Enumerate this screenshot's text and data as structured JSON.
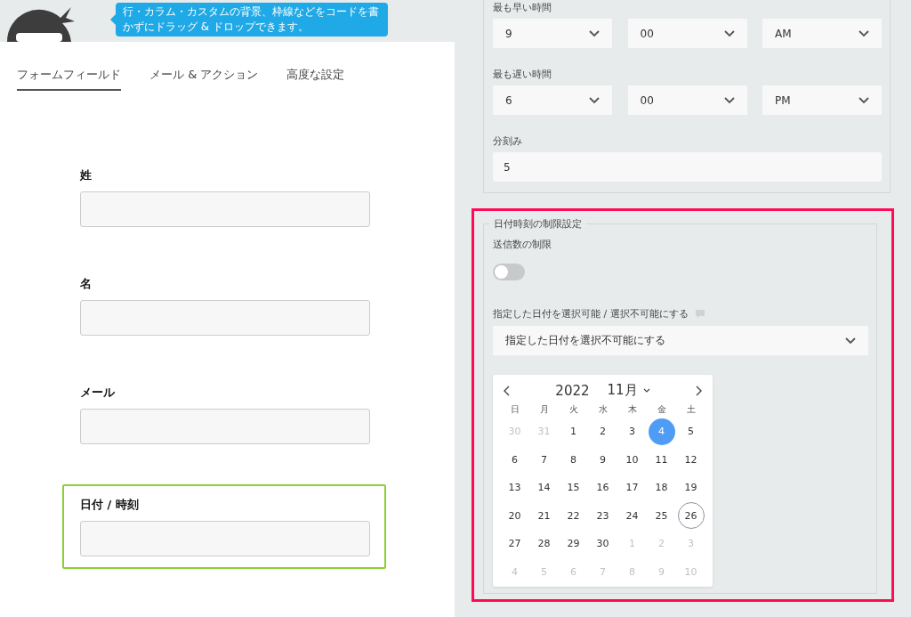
{
  "tooltip": "行・カラム・カスタムの背景、枠線などをコードを書かずにドラッグ & ドロップできます。",
  "tabs": [
    {
      "label": "フォームフィールド",
      "selected": true
    },
    {
      "label": "メール & アクション",
      "selected": false
    },
    {
      "label": "高度な設定",
      "selected": false
    }
  ],
  "fields": [
    {
      "label": "姓",
      "selected": false
    },
    {
      "label": "名",
      "selected": false
    },
    {
      "label": "メール",
      "selected": false
    },
    {
      "label": "日付 / 時刻",
      "selected": true
    }
  ],
  "time_settings": [
    {
      "label": "最も早い時間",
      "hour": "9",
      "minute": "00",
      "period": "AM"
    },
    {
      "label": "最も遅い時間",
      "hour": "6",
      "minute": "00",
      "period": "PM"
    }
  ],
  "interval": {
    "label": "分刻み",
    "value": "5"
  },
  "restrictions": {
    "legend": "日付時刻の制限設定",
    "limit_label": "送信数の制限",
    "limit_on": false,
    "dates_label": "指定した日付を選択可能 / 選択不可能にする",
    "dates_mode": "指定した日付を選択不可能にする"
  },
  "calendar": {
    "year": "2022",
    "month": "11月",
    "weekdays": [
      "日",
      "月",
      "火",
      "水",
      "木",
      "金",
      "土"
    ],
    "days": [
      {
        "text": "30",
        "outside": true,
        "selected": false,
        "today": false
      },
      {
        "text": "31",
        "outside": true,
        "selected": false,
        "today": false
      },
      {
        "text": "1",
        "outside": false,
        "selected": false,
        "today": false
      },
      {
        "text": "2",
        "outside": false,
        "selected": false,
        "today": false
      },
      {
        "text": "3",
        "outside": false,
        "selected": false,
        "today": false
      },
      {
        "text": "4",
        "outside": false,
        "selected": true,
        "today": false
      },
      {
        "text": "5",
        "outside": false,
        "selected": false,
        "today": false
      },
      {
        "text": "6",
        "outside": false,
        "selected": false,
        "today": false
      },
      {
        "text": "7",
        "outside": false,
        "selected": false,
        "today": false
      },
      {
        "text": "8",
        "outside": false,
        "selected": false,
        "today": false
      },
      {
        "text": "9",
        "outside": false,
        "selected": false,
        "today": false
      },
      {
        "text": "10",
        "outside": false,
        "selected": false,
        "today": false
      },
      {
        "text": "11",
        "outside": false,
        "selected": false,
        "today": false
      },
      {
        "text": "12",
        "outside": false,
        "selected": false,
        "today": false
      },
      {
        "text": "13",
        "outside": false,
        "selected": false,
        "today": false
      },
      {
        "text": "14",
        "outside": false,
        "selected": false,
        "today": false
      },
      {
        "text": "15",
        "outside": false,
        "selected": false,
        "today": false
      },
      {
        "text": "16",
        "outside": false,
        "selected": false,
        "today": false
      },
      {
        "text": "17",
        "outside": false,
        "selected": false,
        "today": false
      },
      {
        "text": "18",
        "outside": false,
        "selected": false,
        "today": false
      },
      {
        "text": "19",
        "outside": false,
        "selected": false,
        "today": false
      },
      {
        "text": "20",
        "outside": false,
        "selected": false,
        "today": false
      },
      {
        "text": "21",
        "outside": false,
        "selected": false,
        "today": false
      },
      {
        "text": "22",
        "outside": false,
        "selected": false,
        "today": false
      },
      {
        "text": "23",
        "outside": false,
        "selected": false,
        "today": false
      },
      {
        "text": "24",
        "outside": false,
        "selected": false,
        "today": false
      },
      {
        "text": "25",
        "outside": false,
        "selected": false,
        "today": false
      },
      {
        "text": "26",
        "outside": false,
        "selected": false,
        "today": true
      },
      {
        "text": "27",
        "outside": false,
        "selected": false,
        "today": false
      },
      {
        "text": "28",
        "outside": false,
        "selected": false,
        "today": false
      },
      {
        "text": "29",
        "outside": false,
        "selected": false,
        "today": false
      },
      {
        "text": "30",
        "outside": false,
        "selected": false,
        "today": false
      },
      {
        "text": "1",
        "outside": true,
        "selected": false,
        "today": false
      },
      {
        "text": "2",
        "outside": true,
        "selected": false,
        "today": false
      },
      {
        "text": "3",
        "outside": true,
        "selected": false,
        "today": false
      },
      {
        "text": "4",
        "outside": true,
        "selected": false,
        "today": false
      },
      {
        "text": "5",
        "outside": true,
        "selected": false,
        "today": false
      },
      {
        "text": "6",
        "outside": true,
        "selected": false,
        "today": false
      },
      {
        "text": "7",
        "outside": true,
        "selected": false,
        "today": false
      },
      {
        "text": "8",
        "outside": true,
        "selected": false,
        "today": false
      },
      {
        "text": "9",
        "outside": true,
        "selected": false,
        "today": false
      },
      {
        "text": "10",
        "outside": true,
        "selected": false,
        "today": false
      }
    ]
  }
}
